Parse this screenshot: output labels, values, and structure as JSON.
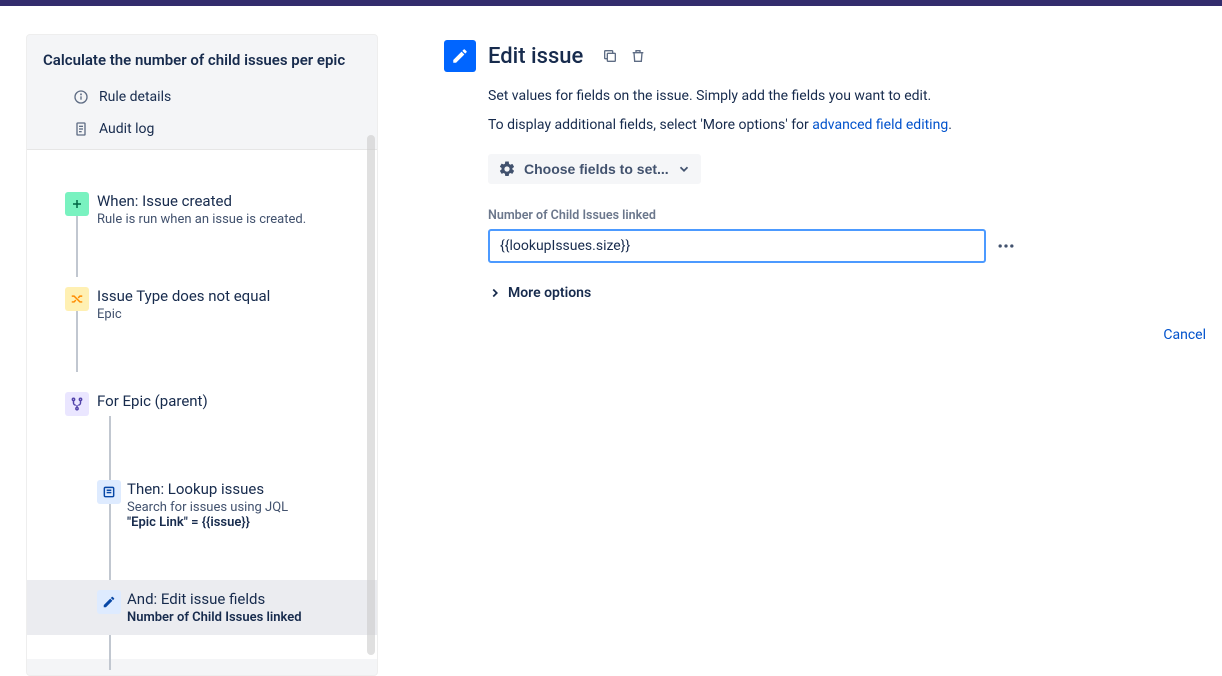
{
  "sidebar": {
    "title": "Calculate the number of child issues per epic",
    "rule_details": "Rule details",
    "audit_log": "Audit log",
    "steps": [
      {
        "title": "When: Issue created",
        "sub": "Rule is run when an issue is created."
      },
      {
        "title": "Issue Type does not equal",
        "sub": "Epic"
      },
      {
        "title": "For Epic (parent)",
        "sub": ""
      },
      {
        "title": "Then: Lookup issues",
        "sub": "Search for issues using JQL",
        "strong": "\"Epic Link\" = {{issue}}"
      },
      {
        "title": "And: Edit issue fields",
        "strong": "Number of Child Issues linked"
      }
    ]
  },
  "main": {
    "title": "Edit issue",
    "desc1": "Set values for fields on the issue. Simply add the fields you want to edit.",
    "desc2_prefix": "To display additional fields, select 'More options' for ",
    "desc2_link": "advanced field editing",
    "choose_label": "Choose fields to set...",
    "field_label": "Number of Child Issues linked",
    "field_value": "{{lookupIssues.size}}",
    "more_options": "More options",
    "cancel": "Cancel"
  }
}
